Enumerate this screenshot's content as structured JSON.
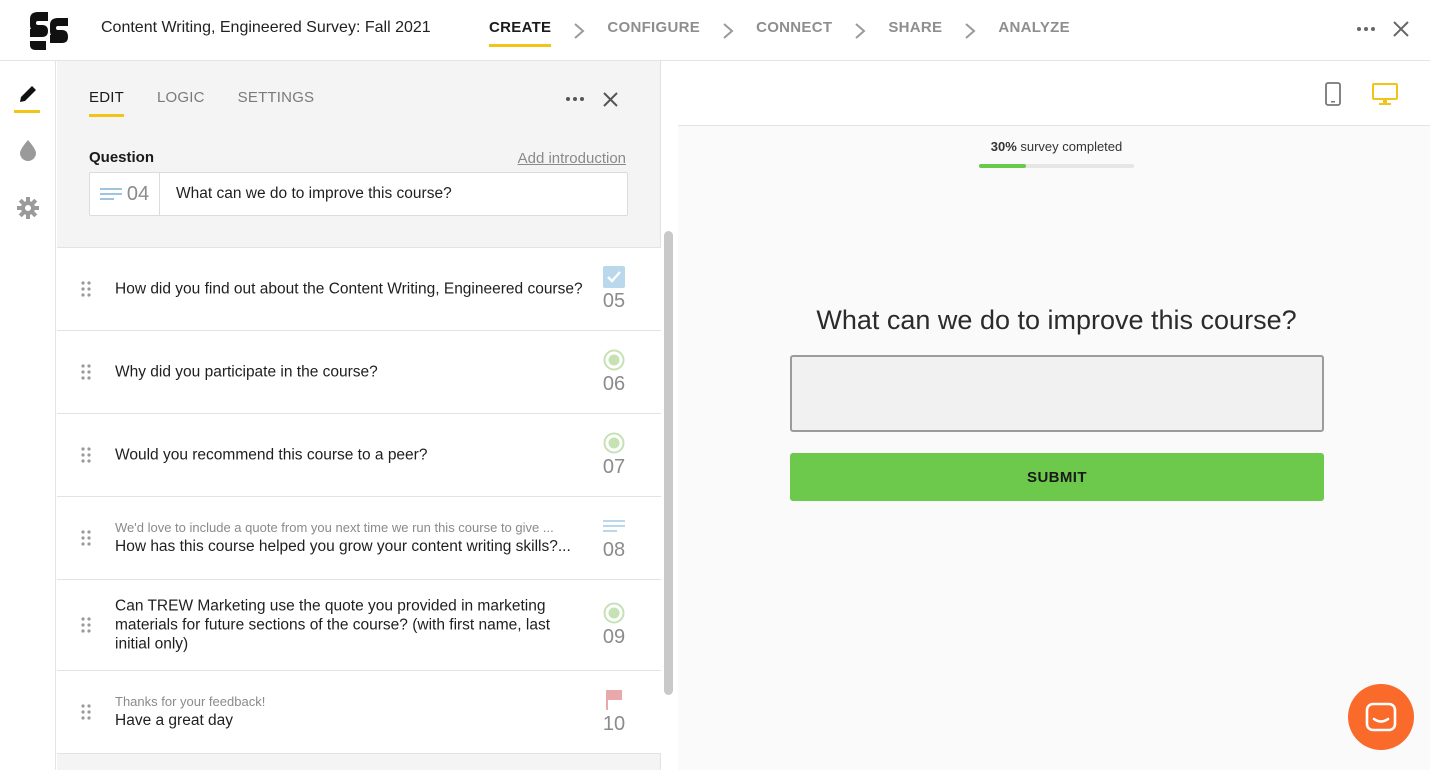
{
  "header": {
    "survey_title": "Content Writing, Engineered Survey: Fall 2021",
    "steps": [
      "CREATE",
      "CONFIGURE",
      "CONNECT",
      "SHARE",
      "ANALYZE"
    ],
    "active_step": "CREATE"
  },
  "editor": {
    "tabs": [
      "EDIT",
      "LOGIC",
      "SETTINGS"
    ],
    "question_label": "Question",
    "add_introduction": "Add introduction",
    "current": {
      "number": "04",
      "text": "What can we do to improve this course?",
      "type_icon": "text-lines-icon"
    },
    "questions": [
      {
        "number": "05",
        "sub": "",
        "text": "How did you find out about the Content Writing, Engineered course?",
        "type_icon": "checkbox-icon"
      },
      {
        "number": "06",
        "sub": "",
        "text": "Why did you participate in the course?",
        "type_icon": "radio-icon"
      },
      {
        "number": "07",
        "sub": "",
        "text": "Would you recommend this course to a peer?",
        "type_icon": "radio-icon"
      },
      {
        "number": "08",
        "sub": "We'd love to include a quote from you next time we run this course to give ...",
        "text": "How has this course helped you grow your content writing skills?...",
        "type_icon": "text-lines-icon"
      },
      {
        "number": "09",
        "sub": "",
        "text": "Can TREW Marketing use the quote you provided in marketing materials for future sections of the course? (with first name, last initial only)",
        "type_icon": "radio-icon"
      },
      {
        "number": "10",
        "sub": "Thanks for your feedback!",
        "text": "Have a great day",
        "type_icon": "flag-icon"
      }
    ]
  },
  "preview": {
    "progress_percent": "30%",
    "progress_suffix": " survey completed",
    "progress_value": 0.3,
    "question": "What can we do to improve this course?",
    "submit_label": "SUBMIT"
  },
  "colors": {
    "accent": "#f2c417",
    "green": "#6cc94b",
    "chat": "#f96a2b"
  }
}
